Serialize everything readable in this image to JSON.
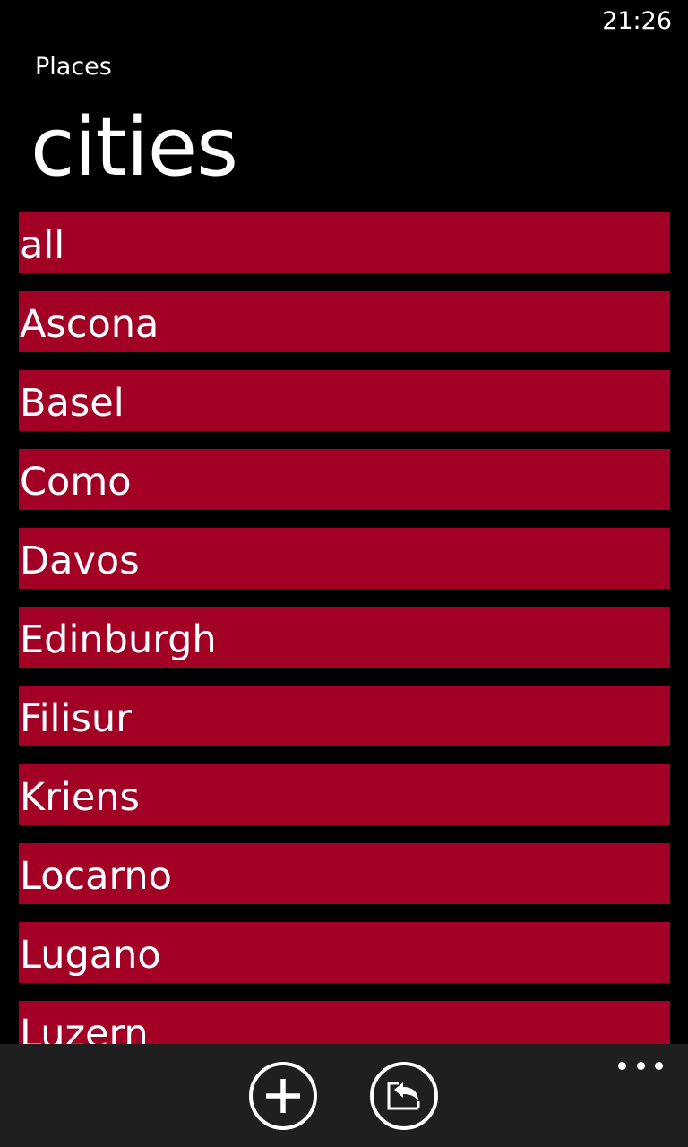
{
  "status_bar": {
    "time": "21:26"
  },
  "header": {
    "app_title": "Places",
    "page_title": "cities"
  },
  "cities": [
    "all",
    "Ascona",
    "Basel",
    "Como",
    "Davos",
    "Edinburgh",
    "Filisur",
    "Kriens",
    "Locarno",
    "Lugano",
    "Luzern"
  ],
  "app_bar": {
    "buttons": [
      {
        "name": "add-button",
        "icon": "plus-circle-icon"
      },
      {
        "name": "signout-button",
        "icon": "exit-arrow-icon"
      }
    ],
    "more_icon": "ellipsis-icon"
  },
  "colors": {
    "background": "#000000",
    "accent": "#a20025",
    "app_bar": "#1f1f1f",
    "foreground": "#ffffff"
  }
}
